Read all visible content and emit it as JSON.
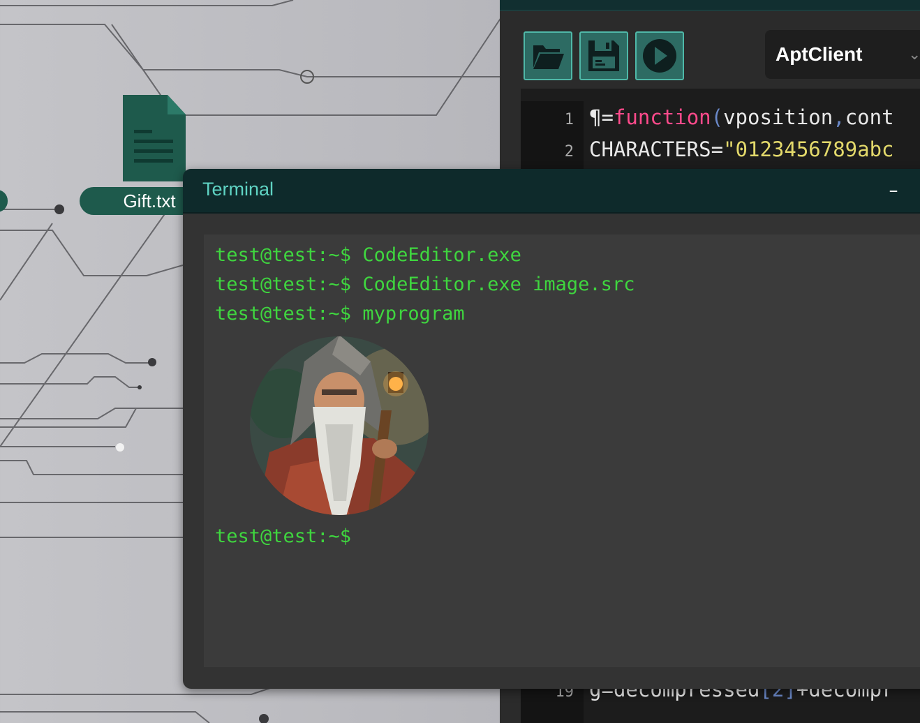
{
  "desktop": {
    "file": {
      "label": "Gift.txt",
      "icon": "document-icon"
    }
  },
  "editor": {
    "toolbar": {
      "open_icon": "folder-open-icon",
      "save_icon": "floppy-disk-icon",
      "run_icon": "play-icon"
    },
    "project": {
      "selected": "AptClient",
      "chevron": "⌄"
    },
    "lines": [
      {
        "num": "1",
        "tokens": [
          {
            "t": "¶",
            "c": "op"
          },
          {
            "t": "=",
            "c": "op"
          },
          {
            "t": "function",
            "c": "kw"
          },
          {
            "t": "(",
            "c": "paren"
          },
          {
            "t": "vposition",
            "c": "op"
          },
          {
            "t": ",",
            "c": "paren"
          },
          {
            "t": "cont",
            "c": "op"
          }
        ]
      },
      {
        "num": "2",
        "tokens": [
          {
            "t": "CHARACTERS",
            "c": "op"
          },
          {
            "t": "=",
            "c": "op"
          },
          {
            "t": "\"0123456789abc",
            "c": "str"
          }
        ]
      },
      {
        "num": "19",
        "tokens": [
          {
            "t": "g",
            "c": "op"
          },
          {
            "t": "=",
            "c": "op"
          },
          {
            "t": "decompressed",
            "c": "op"
          },
          {
            "t": "[",
            "c": "paren"
          },
          {
            "t": "2",
            "c": "paren"
          },
          {
            "t": "]",
            "c": "paren"
          },
          {
            "t": "+",
            "c": "op"
          },
          {
            "t": "decompr",
            "c": "op"
          }
        ]
      }
    ]
  },
  "terminal": {
    "title": "Terminal",
    "minimize": "–",
    "lines": [
      "test@test:~$ CodeEditor.exe",
      "test@test:~$ CodeEditor.exe image.src",
      "test@test:~$ myprogram"
    ],
    "prompt": "test@test:~$",
    "image": "wizard-portrait"
  },
  "colors": {
    "accent": "#4fb8a8",
    "terminal_text": "#3fd63f",
    "keyword": "#ff4a8b",
    "string": "#e3d96b"
  }
}
